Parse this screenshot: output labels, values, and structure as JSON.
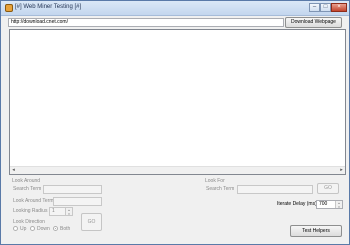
{
  "window": {
    "title": "[#] Web Miner Testing [#]",
    "controls": {
      "minimize": "–",
      "maximize": "□",
      "close": "×"
    }
  },
  "toolbar": {
    "url_value": "http://download.cnet.com/",
    "download_button": "Download Webpage"
  },
  "scroll": {
    "left": "◂",
    "right": "▸"
  },
  "look_around": {
    "heading": "Look Around",
    "search_term_label": "Search Term",
    "look_around_term_label": "Look Around Term",
    "radius_label": "Looking Radius",
    "radius_value": "1",
    "direction_label": "Look Direction",
    "directions": [
      "Up",
      "Down",
      "Both"
    ],
    "selected_direction": "Both",
    "go_button": "GO"
  },
  "look_for": {
    "heading": "Look For",
    "search_term_label": "Search Term",
    "go_button": "GO"
  },
  "iterate": {
    "label": "Iterate Delay (ms)",
    "value": "700"
  },
  "test_helpers_button": "Test Helpers"
}
